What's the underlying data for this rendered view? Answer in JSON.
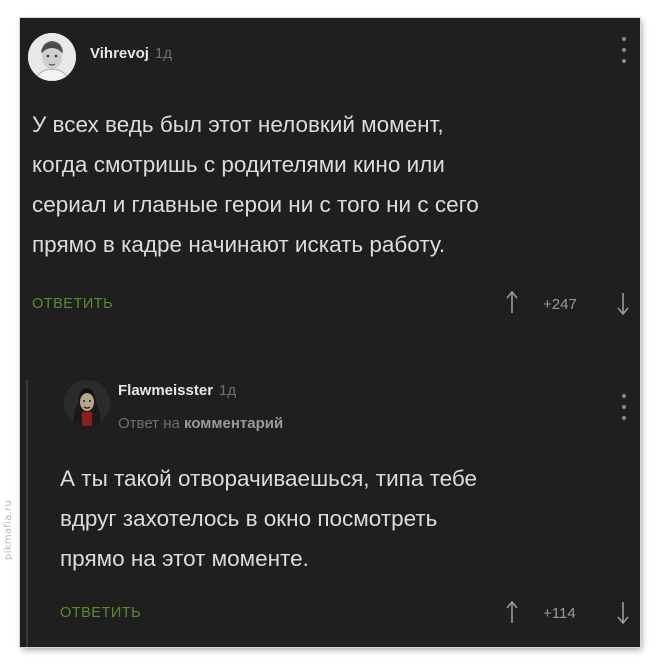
{
  "watermark": "pikmafia.ru",
  "comments": [
    {
      "author": "Vihrevoj",
      "age": "1д",
      "text_lines": [
        "У всех ведь был этот неловкий момент,",
        "когда смотришь с родителями кино или",
        "сериал и главные герои ни с того ни с сего",
        "прямо в кадре начинают искать работу."
      ],
      "reply_label": "ОТВЕТИТЬ",
      "score": "+247"
    },
    {
      "author": "Flawmeisster",
      "age": "1д",
      "reply_to_prefix": "Ответ на",
      "reply_to_link": "комментарий",
      "text_lines": [
        "А ты такой отворачиваешься, типа тебе",
        "вдруг захотелось в окно посмотреть",
        "прямо на этот моменте."
      ],
      "reply_label": "ОТВЕТИТЬ",
      "score": "+114"
    }
  ],
  "colors": {
    "background": "#1f1f1f",
    "text": "#dcdcdc",
    "muted": "#6f6f6f",
    "accent_green": "#5c8a30"
  }
}
